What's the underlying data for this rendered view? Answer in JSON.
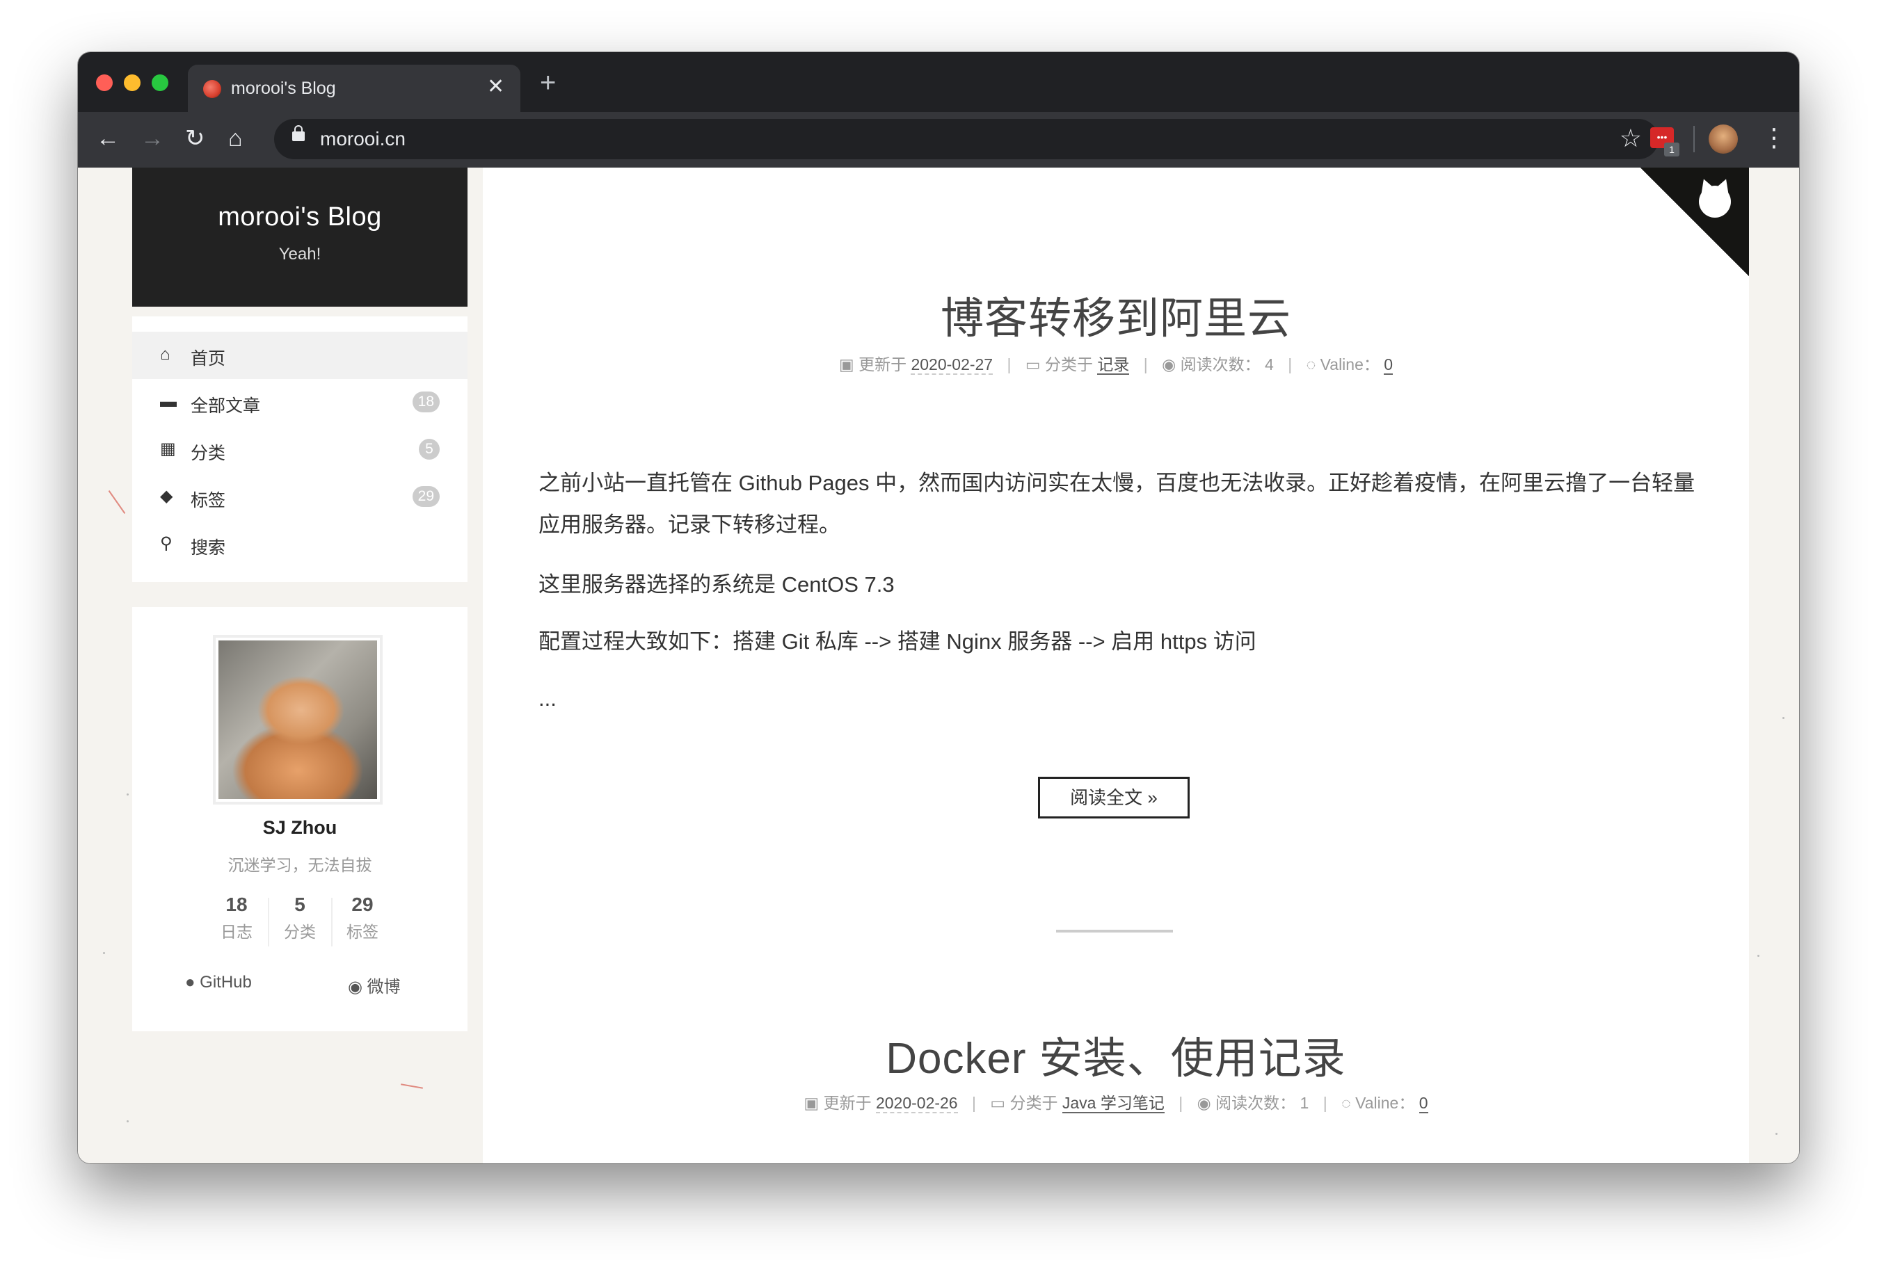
{
  "browser": {
    "tab_title": "morooi's Blog",
    "url": "morooi.cn",
    "extension_badge": "1"
  },
  "site": {
    "title": "morooi's Blog",
    "subtitle": "Yeah!"
  },
  "menu": [
    {
      "label": "首页",
      "icon": "home-icon",
      "active": true
    },
    {
      "label": "全部文章",
      "icon": "archive-icon",
      "badge": "18"
    },
    {
      "label": "分类",
      "icon": "grid-icon",
      "badge": "5"
    },
    {
      "label": "标签",
      "icon": "tags-icon",
      "badge": "29"
    },
    {
      "label": "搜索",
      "icon": "search-icon"
    }
  ],
  "author": {
    "name": "SJ Zhou",
    "description": "沉迷学习，无法自拔",
    "stats": [
      {
        "num": "18",
        "label": "日志"
      },
      {
        "num": "5",
        "label": "分类"
      },
      {
        "num": "29",
        "label": "标签"
      }
    ],
    "links": [
      {
        "label": "GitHub",
        "icon": "github-icon"
      },
      {
        "label": "微博",
        "icon": "weibo-icon"
      }
    ]
  },
  "posts": [
    {
      "title": "博客转移到阿里云",
      "updated_label": "更新于",
      "date": "2020-02-27",
      "category_label": "分类于",
      "category": "记录",
      "views_label": "阅读次数：",
      "views": "4",
      "comments_label": "Valine：",
      "comments": "0",
      "paragraphs": [
        "之前小站一直托管在  Github Pages 中，然而国内访问实在太慢，百度也无法收录。正好趁着疫情，在阿里云撸了一台轻量应用服务器。记录下转移过程。",
        "这里服务器选择的系统是 CentOS 7.3",
        "配置过程大致如下：搭建 Git 私库 --> 搭建 Nginx 服务器 --> 启用 https 访问",
        "..."
      ],
      "read_more": "阅读全文 »"
    },
    {
      "title": "Docker 安装、使用记录",
      "updated_label": "更新于",
      "date": "2020-02-26",
      "category_label": "分类于",
      "category": "Java 学习笔记",
      "views_label": "阅读次数：",
      "views": "1",
      "comments_label": "Valine：",
      "comments": "0"
    }
  ]
}
